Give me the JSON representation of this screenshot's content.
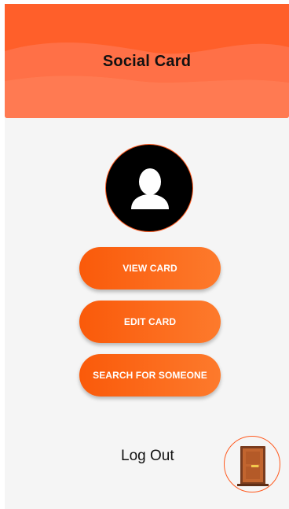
{
  "header": {
    "title": "Social Card"
  },
  "profile": {
    "avatar_icon": "person-icon"
  },
  "buttons": {
    "view_card": "VIEW CARD",
    "edit_card": "EDIT CARD",
    "search": "SEARCH FOR SOMEONE"
  },
  "logout": {
    "label": "Log Out",
    "icon": "door-icon"
  },
  "colors": {
    "accent": "#ff6b35",
    "button_start": "#fa5a0a",
    "button_end": "#fd7a2c",
    "background": "#f5f5f5"
  }
}
